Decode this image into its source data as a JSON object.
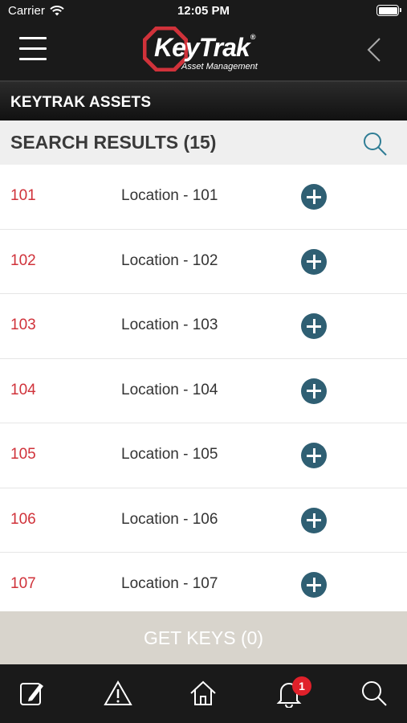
{
  "status": {
    "carrier": "Carrier",
    "time": "12:05 PM"
  },
  "header": {
    "logo_text": "KeyTrak",
    "logo_registered": "®",
    "logo_tagline": "Asset Management"
  },
  "title": "KEYTRAK ASSETS",
  "search": {
    "heading": "SEARCH RESULTS (15)"
  },
  "results": [
    {
      "id": "101",
      "location": "Location - 101"
    },
    {
      "id": "102",
      "location": "Location - 102"
    },
    {
      "id": "103",
      "location": "Location - 103"
    },
    {
      "id": "104",
      "location": "Location - 104"
    },
    {
      "id": "105",
      "location": "Location - 105"
    },
    {
      "id": "106",
      "location": "Location - 106"
    },
    {
      "id": "107",
      "location": "Location - 107"
    }
  ],
  "get_keys_label": "GET KEYS (0)",
  "tabbar": {
    "items": [
      "edit-icon",
      "warning-icon",
      "home-icon",
      "bell-icon",
      "search-icon"
    ],
    "notification_count": "1"
  },
  "colors": {
    "accent_red": "#d0323a",
    "add_button": "#2f5f73",
    "header_bg": "#1a1a1a"
  }
}
